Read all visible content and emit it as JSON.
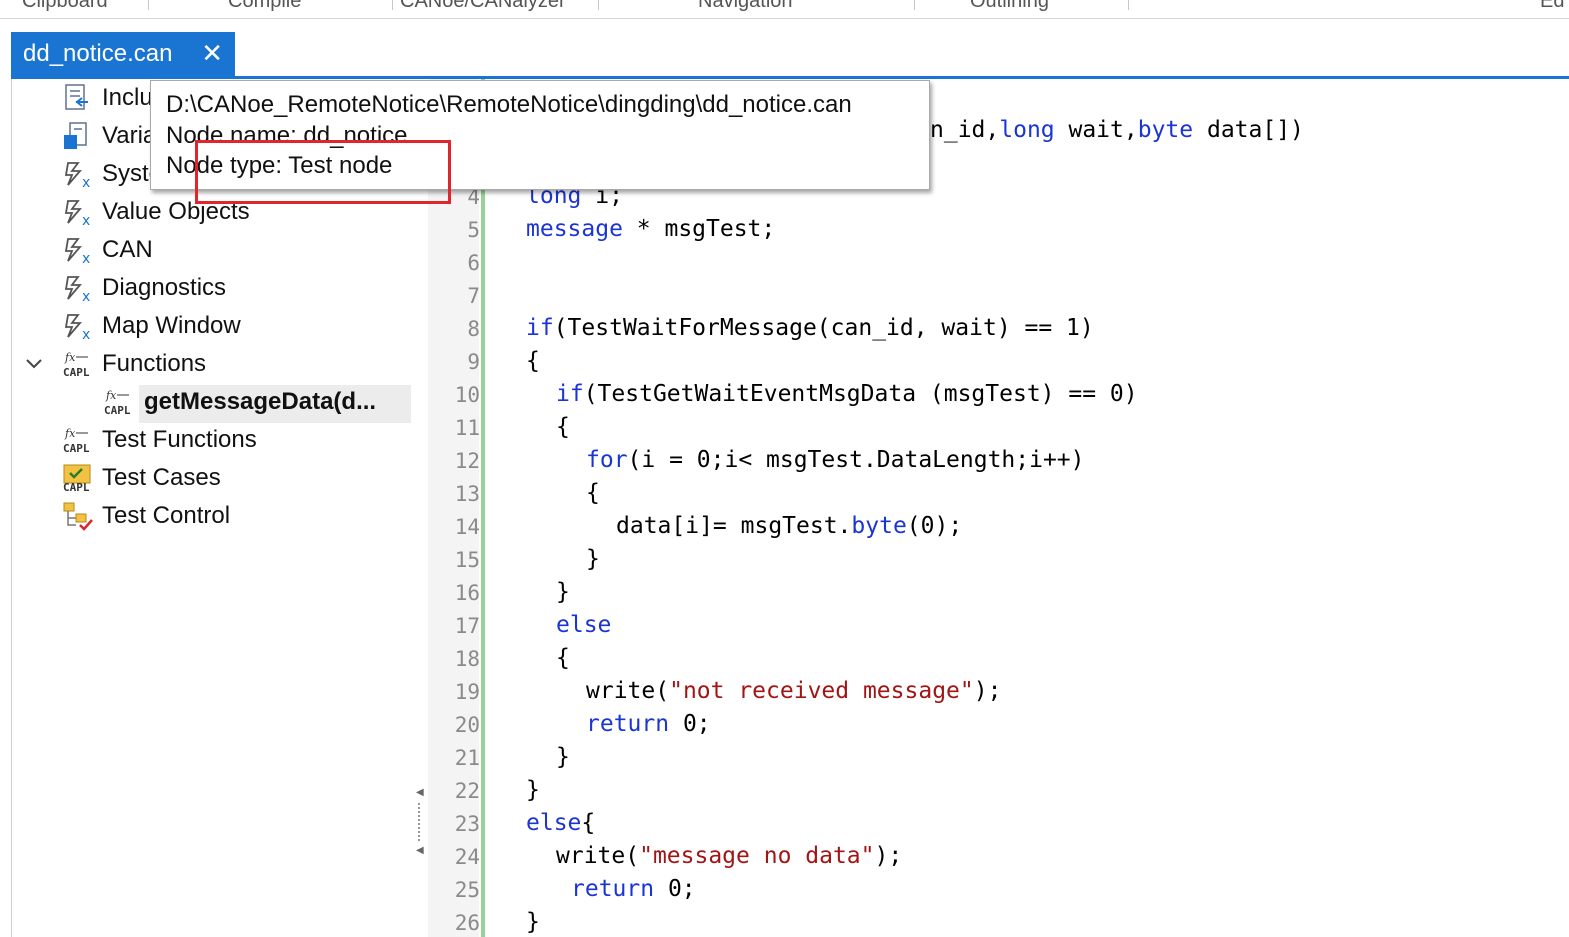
{
  "ribbon": {
    "groups": [
      "Clipboard",
      "Compile",
      "CANoe/CANalyzer",
      "Navigation",
      "Outlining",
      "Ed"
    ]
  },
  "tab": {
    "title": "dd_notice.can",
    "close_glyph": "✕"
  },
  "tree": {
    "items": [
      {
        "label": "Inclu",
        "icon": "includes-icon"
      },
      {
        "label": "Varia",
        "icon": "variables-icon"
      },
      {
        "label": "Syste",
        "icon": "system-icon"
      },
      {
        "label": "Value Objects",
        "icon": "value-objects-icon"
      },
      {
        "label": "CAN",
        "icon": "can-icon"
      },
      {
        "label": "Diagnostics",
        "icon": "diagnostics-icon"
      },
      {
        "label": "Map Window",
        "icon": "map-window-icon"
      },
      {
        "label": "Functions",
        "icon": "capl-functions-icon",
        "expanded": true
      },
      {
        "label": "getMessageData(d...",
        "icon": "capl-function-icon",
        "selected": true
      },
      {
        "label": "Test Functions",
        "icon": "capl-test-functions-icon"
      },
      {
        "label": "Test Cases",
        "icon": "test-cases-icon"
      },
      {
        "label": "Test Control",
        "icon": "test-control-icon"
      }
    ]
  },
  "tooltip": {
    "path": "D:\\CANoe_RemoteNotice\\RemoteNotice\\dingding\\dd_notice.can",
    "node_name": "Node name: dd_notice",
    "node_type": "Node type: Test node"
  },
  "editor": {
    "line_numbers": [
      "4",
      "5",
      "6",
      "7",
      "8",
      "9",
      "10",
      "11",
      "12",
      "13",
      "14",
      "15",
      "16",
      "17",
      "18",
      "19",
      "20",
      "21",
      "22",
      "23",
      "24",
      "25",
      "26"
    ],
    "signature_tail": "n_id,long wait,byte data[])"
  },
  "colors": {
    "accent": "#1a75d2",
    "keyword": "#1b34d6",
    "string": "#a31515",
    "highlight_box": "#e0262c"
  }
}
